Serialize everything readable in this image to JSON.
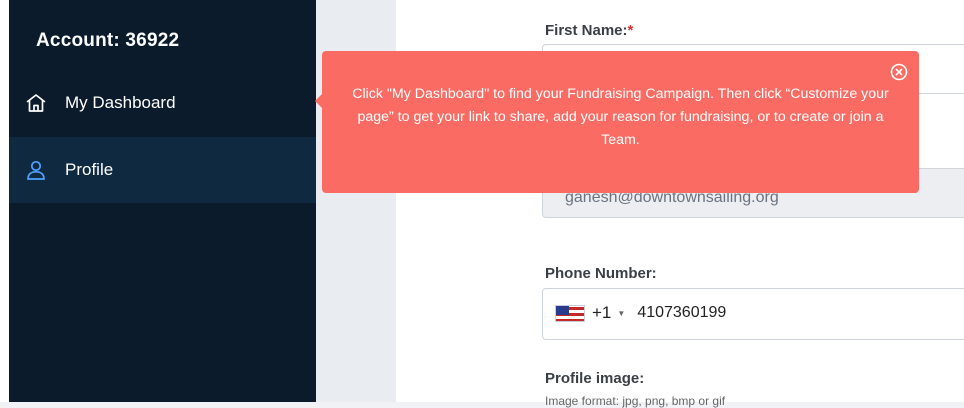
{
  "sidebar": {
    "account_label": "Account: 36922",
    "items": [
      {
        "label": "My Dashboard",
        "icon": "home-icon"
      },
      {
        "label": "Profile",
        "icon": "user-icon"
      }
    ]
  },
  "form": {
    "first_name_label": "First Name:",
    "required_mark": "*",
    "email_value": "ganesh@downtownsailing.org",
    "phone_label": "Phone Number:",
    "phone_country_code": "+1",
    "phone_value": "4107360199",
    "profile_image_label": "Profile image:",
    "profile_image_hint": "Image format: jpg, png, bmp or gif"
  },
  "tooltip": {
    "text": "Click \"My Dashboard\" to find your Fundraising Campaign. Then click “Customize your page” to get your link to share, add your reason for fundraising, or to create or join a Team.",
    "icon": "close-circle-icon"
  },
  "colors": {
    "sidebar_bg": "#0b1b2b",
    "sidebar_active_bg": "#0f2a40",
    "tooltip_bg": "#f96b63",
    "required": "#d32f2f",
    "icon_accent": "#4fa3ff"
  }
}
